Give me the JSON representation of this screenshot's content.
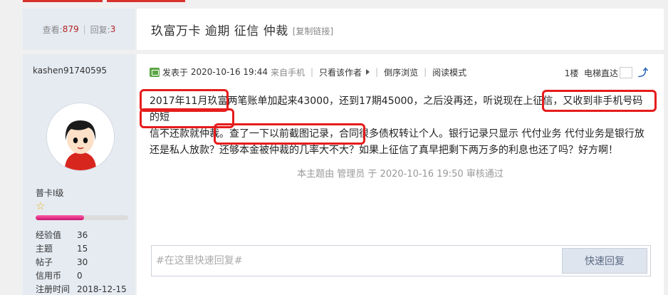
{
  "header": {
    "views_label": "查看:",
    "views": "879",
    "replies_label": "回复:",
    "replies": "3",
    "title": "玖富万卡 逾期 征信 仲裁",
    "copy_link": "[复制链接]"
  },
  "user": {
    "name": "kashen91740595",
    "rank": "普卡I级",
    "exp_progress_pct": 52,
    "stats": [
      {
        "label": "经验值",
        "value": "36"
      },
      {
        "label": "主题",
        "value": "15"
      },
      {
        "label": "帖子",
        "value": "30"
      },
      {
        "label": "信用币",
        "value": "0"
      },
      {
        "label": "注册时间",
        "value": "2018-12-15"
      }
    ]
  },
  "post": {
    "posted_prefix": "发表于",
    "posted_time": "2020-10-16 19:44",
    "source": "来自手机",
    "only_author": "只看该作者",
    "reverse": "倒序浏览",
    "read_mode": "阅读模式",
    "floor": "1楼",
    "elevator": "电梯直达",
    "body_lines": [
      "2017年11月玖富两笔账单加起来43000，还到17期45000，之后没再还，听说现在上征信，又收到非手机号码的短",
      "信不还款就仲裁。查了一下以前截图记录，合同很多债权转让个人。银行记录只显示 代付业务  代付业务是银行放",
      "还是私人放款？还够本金被仲裁的几率大不大？如果上征信了真早把剩下两万多的利息也还了吗？好方啊！"
    ],
    "audit": "本主题由 管理员 于 2020-10-16 19:50 审核通过"
  },
  "reply": {
    "placeholder": "#在这里快速回复#",
    "button": "快速回复"
  },
  "colors": {
    "accent_red": "#e61c1c",
    "count_red": "#b22222",
    "panel_blue": "#e6ebf2"
  }
}
